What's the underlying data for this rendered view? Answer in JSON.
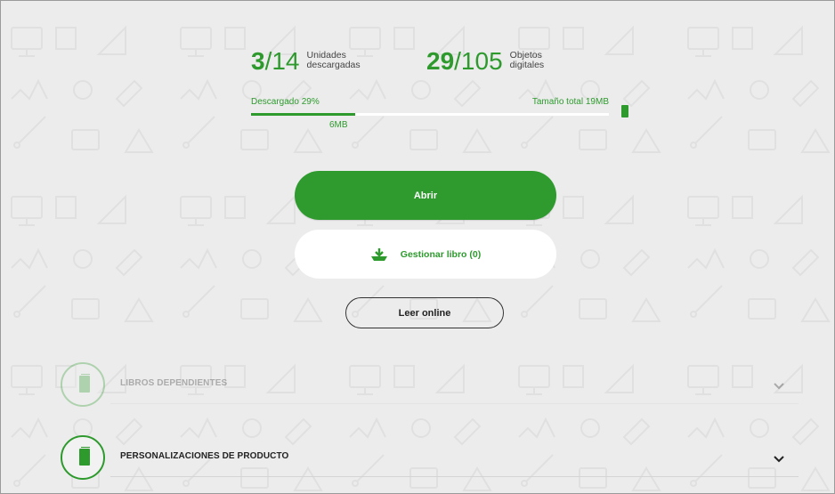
{
  "stats": {
    "units": {
      "downloaded": "3",
      "total": "/14",
      "label_line1": "Unidades",
      "label_line2": "descargadas"
    },
    "objects": {
      "downloaded": "29",
      "total": "/105",
      "label_line1": "Objetos",
      "label_line2": "digitales"
    }
  },
  "progress": {
    "downloaded_label": "Descargado 29%",
    "total_size_label": "Tamaño total 19MB",
    "downloaded_size": "6MB",
    "percent": 29
  },
  "buttons": {
    "open": "Abrir",
    "manage": "Gestionar libro (0)",
    "read_online": "Leer online"
  },
  "sections": [
    {
      "title": "LIBROS DEPENDIENTES",
      "faded": true
    },
    {
      "title": "PERSONALIZACIONES DE PRODUCTO",
      "faded": false
    }
  ],
  "colors": {
    "accent": "#2e9a2e",
    "background": "#ececec"
  },
  "icons": [
    "download-icon",
    "phone-icon",
    "book-icon",
    "chevron-down-icon"
  ]
}
